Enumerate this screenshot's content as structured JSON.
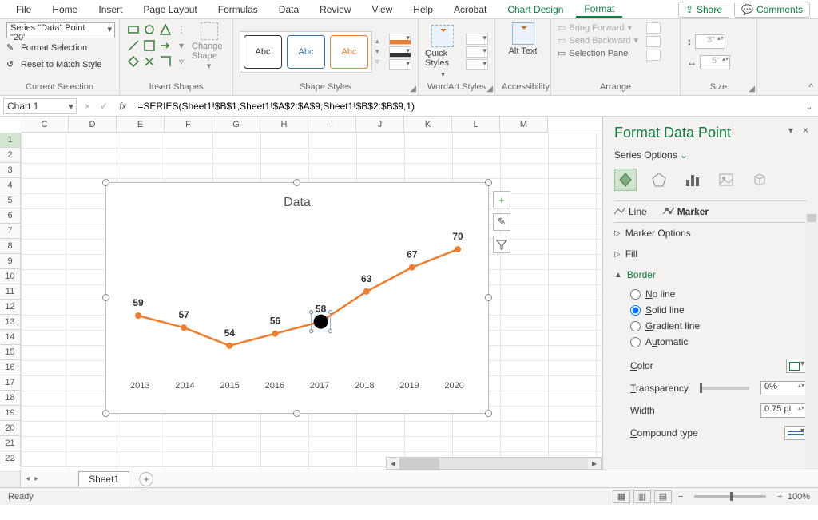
{
  "menu": {
    "items": [
      "File",
      "Home",
      "Insert",
      "Page Layout",
      "Formulas",
      "Data",
      "Review",
      "View",
      "Help",
      "Acrobat",
      "Chart Design",
      "Format"
    ],
    "active": "Format",
    "share": "Share",
    "comments": "Comments"
  },
  "ribbon": {
    "current_selection": {
      "value": "Series \"Data\" Point \"20'",
      "format_selection": "Format Selection",
      "reset": "Reset to Match Style",
      "label": "Current Selection"
    },
    "insert_shapes": {
      "label": "Insert Shapes",
      "change": "Change Shape"
    },
    "shape_styles": {
      "label": "Shape Styles",
      "swatch": "Abc"
    },
    "wordart": {
      "label": "WordArt Styles",
      "quick": "Quick Styles"
    },
    "accessibility": {
      "label": "Accessibility",
      "alt": "Alt Text"
    },
    "arrange": {
      "label": "Arrange",
      "bring_forward": "Bring Forward",
      "send_backward": "Send Backward",
      "selection_pane": "Selection Pane"
    },
    "size": {
      "label": "Size",
      "h": "3\"",
      "w": "5\""
    }
  },
  "formula_bar": {
    "name": "Chart 1",
    "formula": "=SERIES(Sheet1!$B$1,Sheet1!$A$2:$A$9,Sheet1!$B$2:$B$9,1)"
  },
  "columns": [
    "C",
    "D",
    "E",
    "F",
    "G",
    "H",
    "I",
    "J",
    "K",
    "L",
    "M"
  ],
  "rows": [
    1,
    2,
    3,
    4,
    5,
    6,
    7,
    8,
    9,
    10,
    11,
    12,
    13,
    14,
    15,
    16,
    17,
    18,
    19,
    20,
    21,
    22
  ],
  "chart_data": {
    "type": "line",
    "title": "Data",
    "categories": [
      "2013",
      "2014",
      "2015",
      "2016",
      "2017",
      "2018",
      "2019",
      "2020"
    ],
    "values": [
      59,
      57,
      54,
      56,
      58,
      63,
      67,
      70
    ],
    "selected_point_index": 4,
    "color": "#ed7d31",
    "ylim": [
      50,
      72
    ]
  },
  "chart_buttons": {
    "plus": "+",
    "brush": "✎",
    "filter": "⧩"
  },
  "pane": {
    "title": "Format Data Point",
    "subtitle": "Series Options",
    "tabs": {
      "line": "Line",
      "marker": "Marker",
      "active": "Marker"
    },
    "sections": {
      "marker_options": "Marker Options",
      "fill": "Fill",
      "border": "Border"
    },
    "border": {
      "no_line": "No line",
      "solid_line": "Solid line",
      "gradient_line": "Gradient line",
      "automatic": "Automatic",
      "selected": "Solid line",
      "color_label": "Color",
      "transparency_label": "Transparency",
      "transparency_value": "0%",
      "width_label": "Width",
      "width_value": "0.75 pt",
      "compound_label": "Compound type"
    }
  },
  "tabs": {
    "sheet": "Sheet1"
  },
  "status": {
    "ready": "Ready",
    "zoom": "100%"
  }
}
